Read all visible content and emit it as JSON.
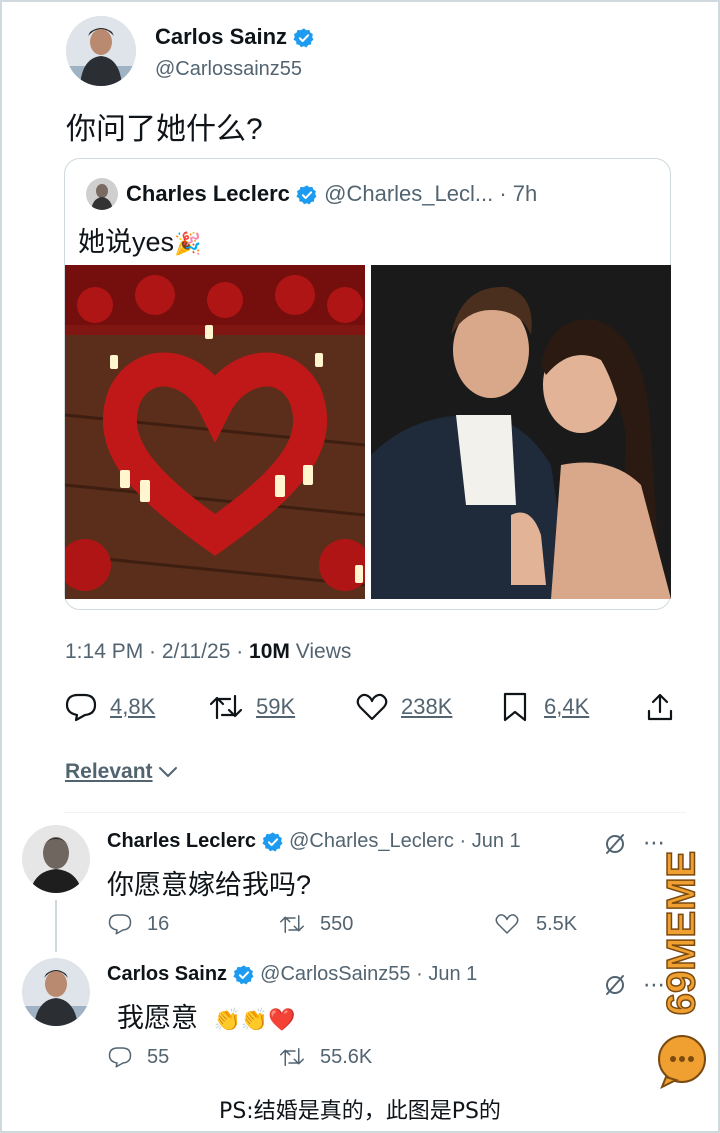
{
  "main_tweet": {
    "author_name": "Carlos Sainz",
    "handle": "@Carlossainz55",
    "text": "你问了她什么?"
  },
  "quoted_tweet": {
    "author_name": "Charles Leclerc",
    "handle": "@Charles_Lecl...",
    "time": "· 7h",
    "text": "她说yes",
    "emoji": "🎉"
  },
  "meta": {
    "time_date": "1:14 PM · 2/11/25 ·",
    "views_count": "10M",
    "views_label": "Views"
  },
  "actions": {
    "replies": "4,8K",
    "retweets": "59K",
    "likes": "238K",
    "bookmarks": "6,4K"
  },
  "sort": {
    "label": "Relevant"
  },
  "replies": [
    {
      "author_name": "Charles Leclerc",
      "handle": "@Charles_Leclerc",
      "date": "· Jun 1",
      "text": "你愿意嫁给我吗?",
      "replies": "16",
      "retweets": "550",
      "likes": "5.5K"
    },
    {
      "author_name": "Carlos Sainz",
      "handle": "@CarlosSainz55",
      "date": "· Jun 1",
      "text": "我愿意",
      "emoji": "👏👏❤️",
      "replies": "55",
      "retweets": "55.6K"
    }
  ],
  "watermark": {
    "text": "69MEME"
  },
  "footer": {
    "caption": "PS:结婚是真的，此图是PS的"
  },
  "colors": {
    "verified": "#1d9bf0",
    "muted": "#536471",
    "watermark": "#f0a030"
  }
}
